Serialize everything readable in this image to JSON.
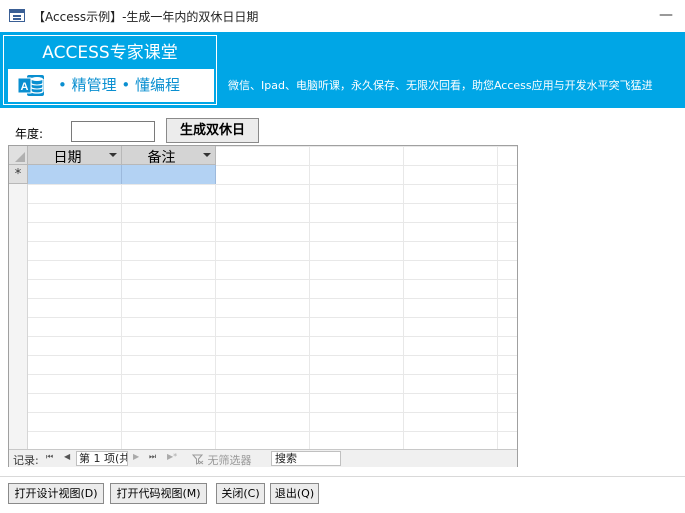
{
  "window": {
    "title": "【Access示例】-生成一年内的双休日日期",
    "minimize_label": "—"
  },
  "banner": {
    "logo_title": "ACCESS专家课堂",
    "logo_tagline": "• 精管理 • 懂编程",
    "marquee": "微信、Ipad、电脑听课，永久保存、无限次回看，助您Access应用与开发水平突飞猛进",
    "color": "#00a6e6"
  },
  "form": {
    "year_label": "年度:",
    "year_value": "",
    "generate_button": "生成双休日"
  },
  "datasheet": {
    "columns": [
      {
        "label": "日期"
      },
      {
        "label": "备注"
      }
    ],
    "new_row_marker": "*",
    "selection_color": "#b3d2f3"
  },
  "navigation": {
    "label": "记录:",
    "first": "⏮",
    "prev": "◀",
    "position": "第 1 项(共",
    "next": "▶",
    "last": "⏭",
    "new": "▶*",
    "filter_label": "无筛选器",
    "search_placeholder": "搜索"
  },
  "buttons": {
    "design_view": "打开设计视图(D)",
    "code_view": "打开代码视图(M)",
    "close": "关闭(C)",
    "exit": "退出(Q)"
  }
}
